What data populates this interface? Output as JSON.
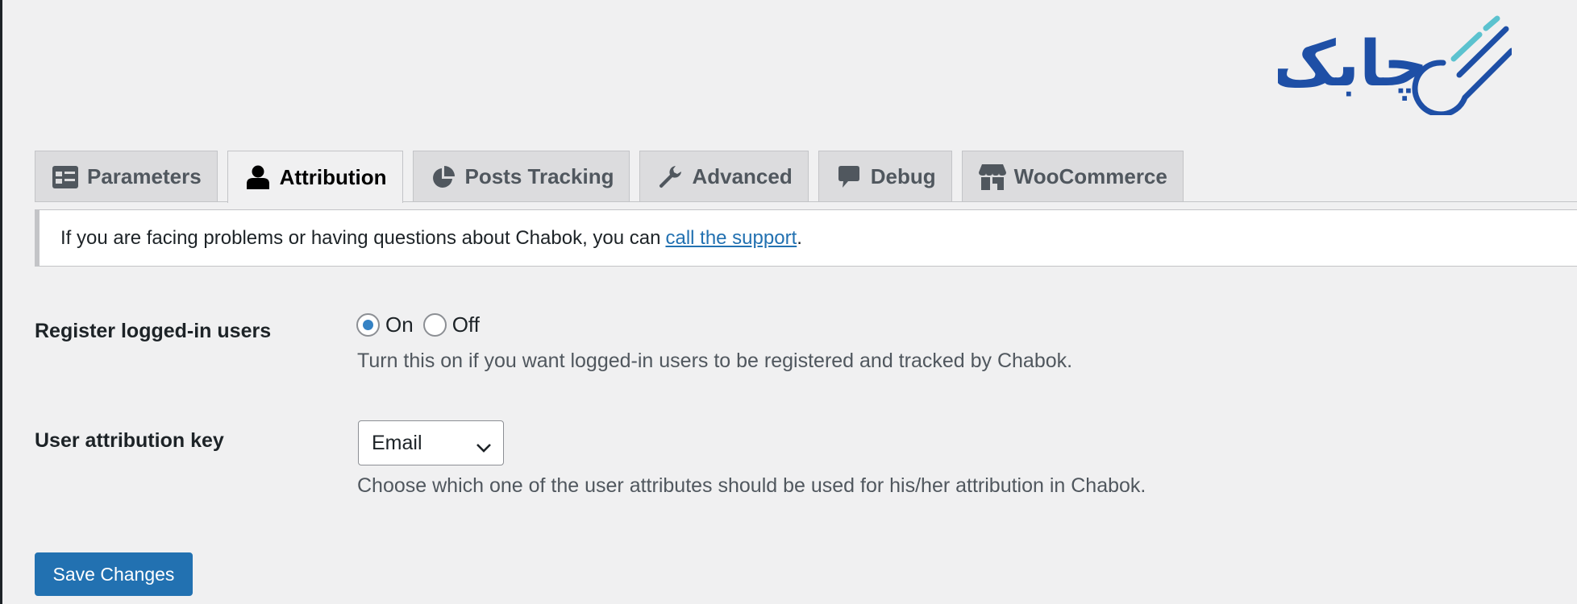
{
  "colors": {
    "page_background": "#f0f0f1",
    "tab_background": "#dcdcde",
    "primary": "#2271b1",
    "link": "#2271b1",
    "logo_blue": "#1e4fa6",
    "logo_accent": "#5bc2cf"
  },
  "logo": {
    "text": "چابک",
    "icon": "chabok-logo"
  },
  "tabs": [
    {
      "label": "Parameters",
      "icon": "table-icon",
      "active": false
    },
    {
      "label": "Attribution",
      "icon": "person-icon",
      "active": true
    },
    {
      "label": "Posts Tracking",
      "icon": "pie-chart-icon",
      "active": false
    },
    {
      "label": "Advanced",
      "icon": "wrench-icon",
      "active": false
    },
    {
      "label": "Debug",
      "icon": "speech-bubble-icon",
      "active": false
    },
    {
      "label": "WooCommerce",
      "icon": "store-icon",
      "active": false
    }
  ],
  "notice": {
    "text_before": "If you are facing problems or having questions about Chabok, you can",
    "link_text": "call the support",
    "text_after": "."
  },
  "settings": {
    "register_logged_in": {
      "label": "Register logged-in users",
      "options": [
        "On",
        "Off"
      ],
      "selected": "On",
      "description": "Turn this on if you want logged-in users to be registered and tracked by Chabok."
    },
    "attribution_key": {
      "label": "User attribution key",
      "selected": "Email",
      "description": "Choose which one of the user attributes should be used for his/her attribution in Chabok."
    }
  },
  "save_button": {
    "label": "Save Changes"
  }
}
